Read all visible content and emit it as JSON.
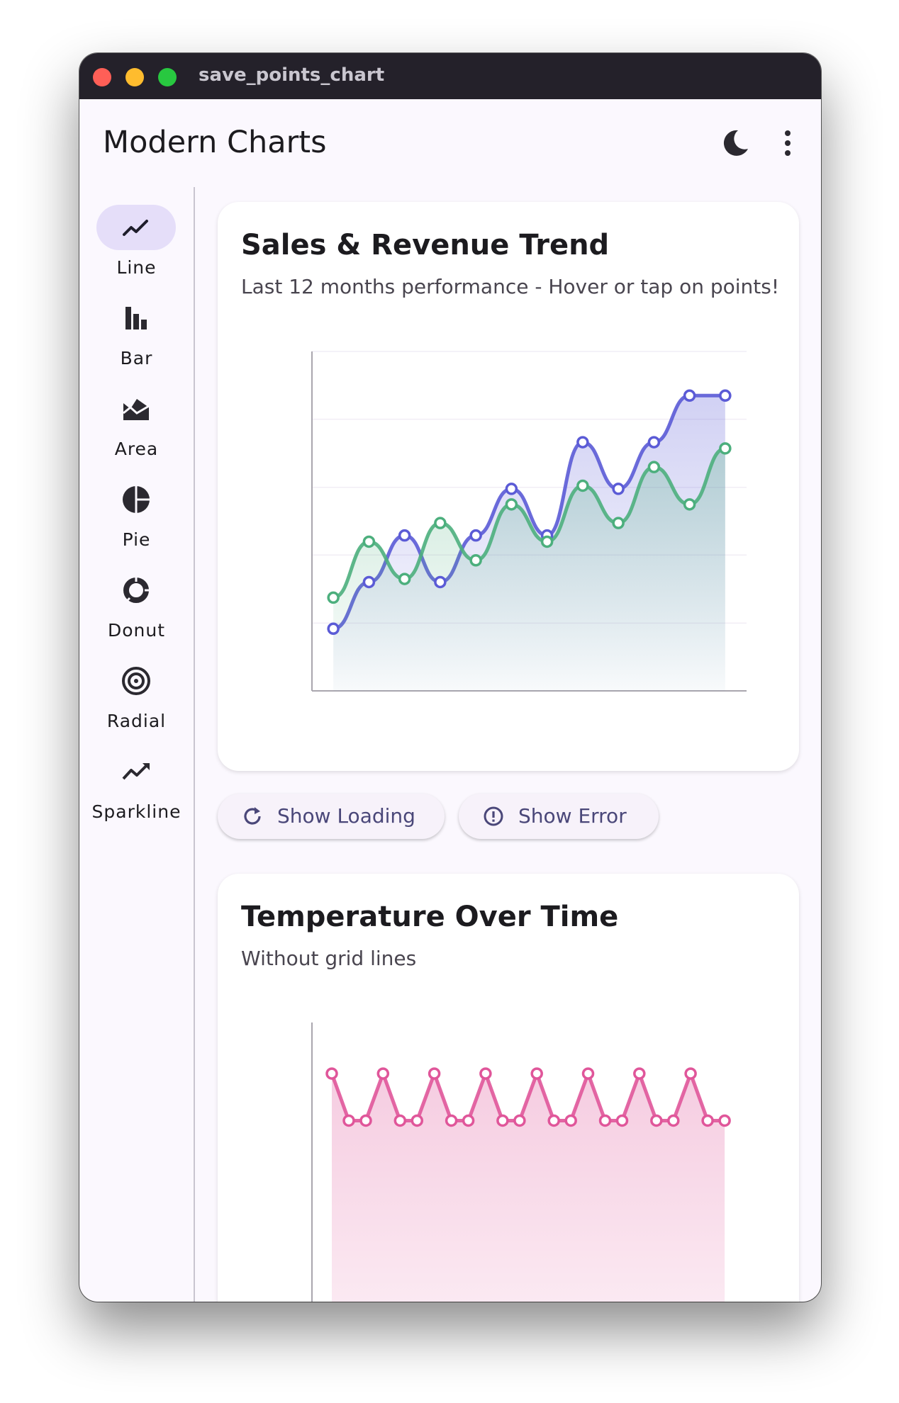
{
  "window": {
    "title": "save_points_chart"
  },
  "appbar": {
    "title": "Modern Charts",
    "theme_icon": "moon-icon",
    "menu_icon": "more-vert-icon"
  },
  "nav": {
    "items": [
      {
        "label": "Line",
        "icon": "line-chart-icon",
        "active": true
      },
      {
        "label": "Bar",
        "icon": "bar-chart-icon",
        "active": false
      },
      {
        "label": "Area",
        "icon": "area-chart-icon",
        "active": false
      },
      {
        "label": "Pie",
        "icon": "pie-chart-icon",
        "active": false
      },
      {
        "label": "Donut",
        "icon": "donut-chart-icon",
        "active": false
      },
      {
        "label": "Radial",
        "icon": "radial-chart-icon",
        "active": false
      },
      {
        "label": "Sparkline",
        "icon": "sparkline-icon",
        "active": false
      }
    ]
  },
  "buttons": {
    "loading": {
      "label": "Show Loading",
      "icon": "refresh-icon"
    },
    "error": {
      "label": "Show Error",
      "icon": "error-icon"
    }
  },
  "colors": {
    "accent": "#5b5bd6",
    "green": "#4caf7d",
    "pink": "#e0569a",
    "nav_active": "#e5def9"
  },
  "chart_data": [
    {
      "type": "area",
      "title": "Sales & Revenue Trend",
      "subtitle": "Last 12 months performance - Hover or tap on points!",
      "x": [
        0,
        1,
        2,
        3,
        4,
        5,
        6,
        7,
        8,
        9,
        10,
        11
      ],
      "series": [
        {
          "color": "#5b5bd6",
          "values": [
            20,
            35,
            50,
            35,
            50,
            65,
            50,
            80,
            65,
            80,
            95,
            95
          ]
        },
        {
          "color": "#4caf7d",
          "values": [
            30,
            48,
            36,
            54,
            42,
            60,
            48,
            66,
            54,
            72,
            60,
            78
          ]
        }
      ],
      "x_ticks": [
        "-0.6",
        "1.5",
        "3.5",
        "5.5",
        "7.5",
        "9.5",
        "11.6"
      ],
      "y_ticks": [
        "0",
        "21.8",
        "43.7",
        "65.5",
        "87.4",
        "109.2"
      ],
      "xlim": [
        -0.6,
        11.6
      ],
      "ylim": [
        0,
        109.2
      ],
      "grid": true
    },
    {
      "type": "area",
      "title": "Temperature Over Time",
      "subtitle": "Without grid lines",
      "x": [
        0,
        1,
        2,
        3,
        4,
        5,
        6,
        7,
        8,
        9,
        10,
        11,
        12,
        13,
        14,
        15,
        16,
        17,
        18,
        19,
        20,
        21,
        22,
        23
      ],
      "series": [
        {
          "color": "#e0569a",
          "values": [
            43,
            36,
            36,
            43,
            36,
            36,
            43,
            36,
            36,
            43,
            36,
            36,
            43,
            36,
            36,
            43,
            36,
            36,
            43,
            36,
            36,
            43,
            36,
            36
          ]
        }
      ],
      "y_ticks": [
        "10.1",
        "20.2",
        "30.4",
        "40.5",
        "50.6"
      ],
      "ylim": [
        0,
        50.6
      ],
      "grid": false
    }
  ]
}
